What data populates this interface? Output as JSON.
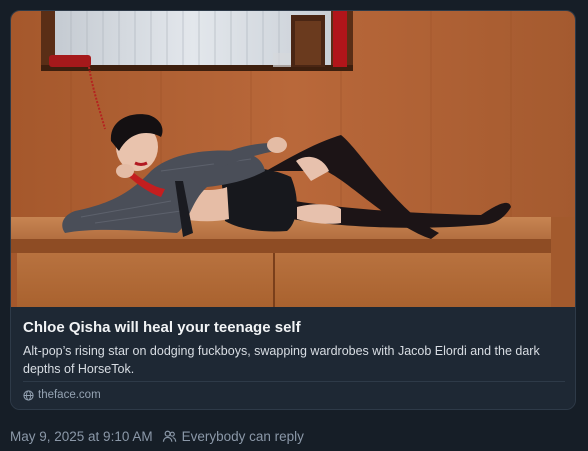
{
  "link_card": {
    "title": "Chloe Qisha will heal your teenage self",
    "description": "Alt-pop’s rising star on dodging fuckboys, swapping wardrobes with Jacob Elordi and the dark depths of HorseTok.",
    "source_domain": "theface.com",
    "source_icon": "globe-icon",
    "image_icon": "photo-woman-lounging-on-wood-bench"
  },
  "post_meta": {
    "timestamp": "May 9, 2025 at 9:10 AM",
    "reply_setting": "Everybody can reply",
    "reply_icon": "people-icon"
  },
  "colors": {
    "background": "#161e27",
    "card_background": "#1e2834",
    "card_border": "#2e3a48",
    "title_text": "#f1f3f5",
    "body_text": "#d8dde3",
    "muted_text": "#8b98a8"
  }
}
